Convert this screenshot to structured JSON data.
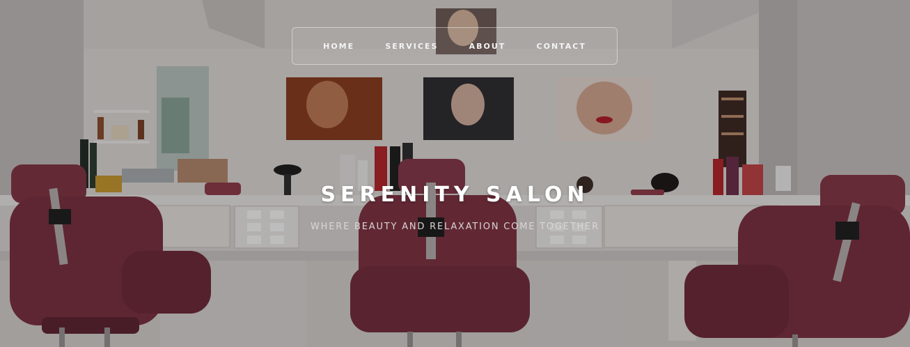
{
  "nav": {
    "items": [
      {
        "label": "HOME"
      },
      {
        "label": "SERVICES"
      },
      {
        "label": "ABOUT"
      },
      {
        "label": "CONTACT"
      }
    ]
  },
  "hero": {
    "title": "SERENITY SALON",
    "subtitle": "WHERE BEAUTY AND RELAXATION COME TOGETHER"
  },
  "colors": {
    "chair": "#7d2f3e",
    "wall": "#d8d5d3",
    "text": "#ffffff"
  }
}
